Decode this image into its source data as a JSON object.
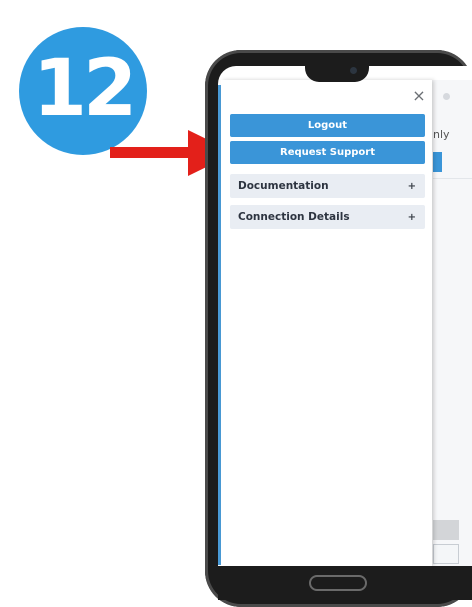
{
  "step": {
    "number": "12"
  },
  "drawer": {
    "close_label": "×",
    "logout_label": "Logout",
    "support_label": "Request Support",
    "sections": [
      {
        "label": "Documentation",
        "toggle": "+"
      },
      {
        "label": "Connection Details",
        "toggle": "+"
      }
    ]
  },
  "background_app": {
    "partial_text": "nly"
  },
  "colors": {
    "step_badge": "#2f9be0",
    "arrow": "#e3201a",
    "primary_button": "#3a95d8",
    "accordion_bg": "#e9edf3"
  },
  "icons": {
    "close": "close-icon",
    "arrow": "right-arrow-icon"
  }
}
